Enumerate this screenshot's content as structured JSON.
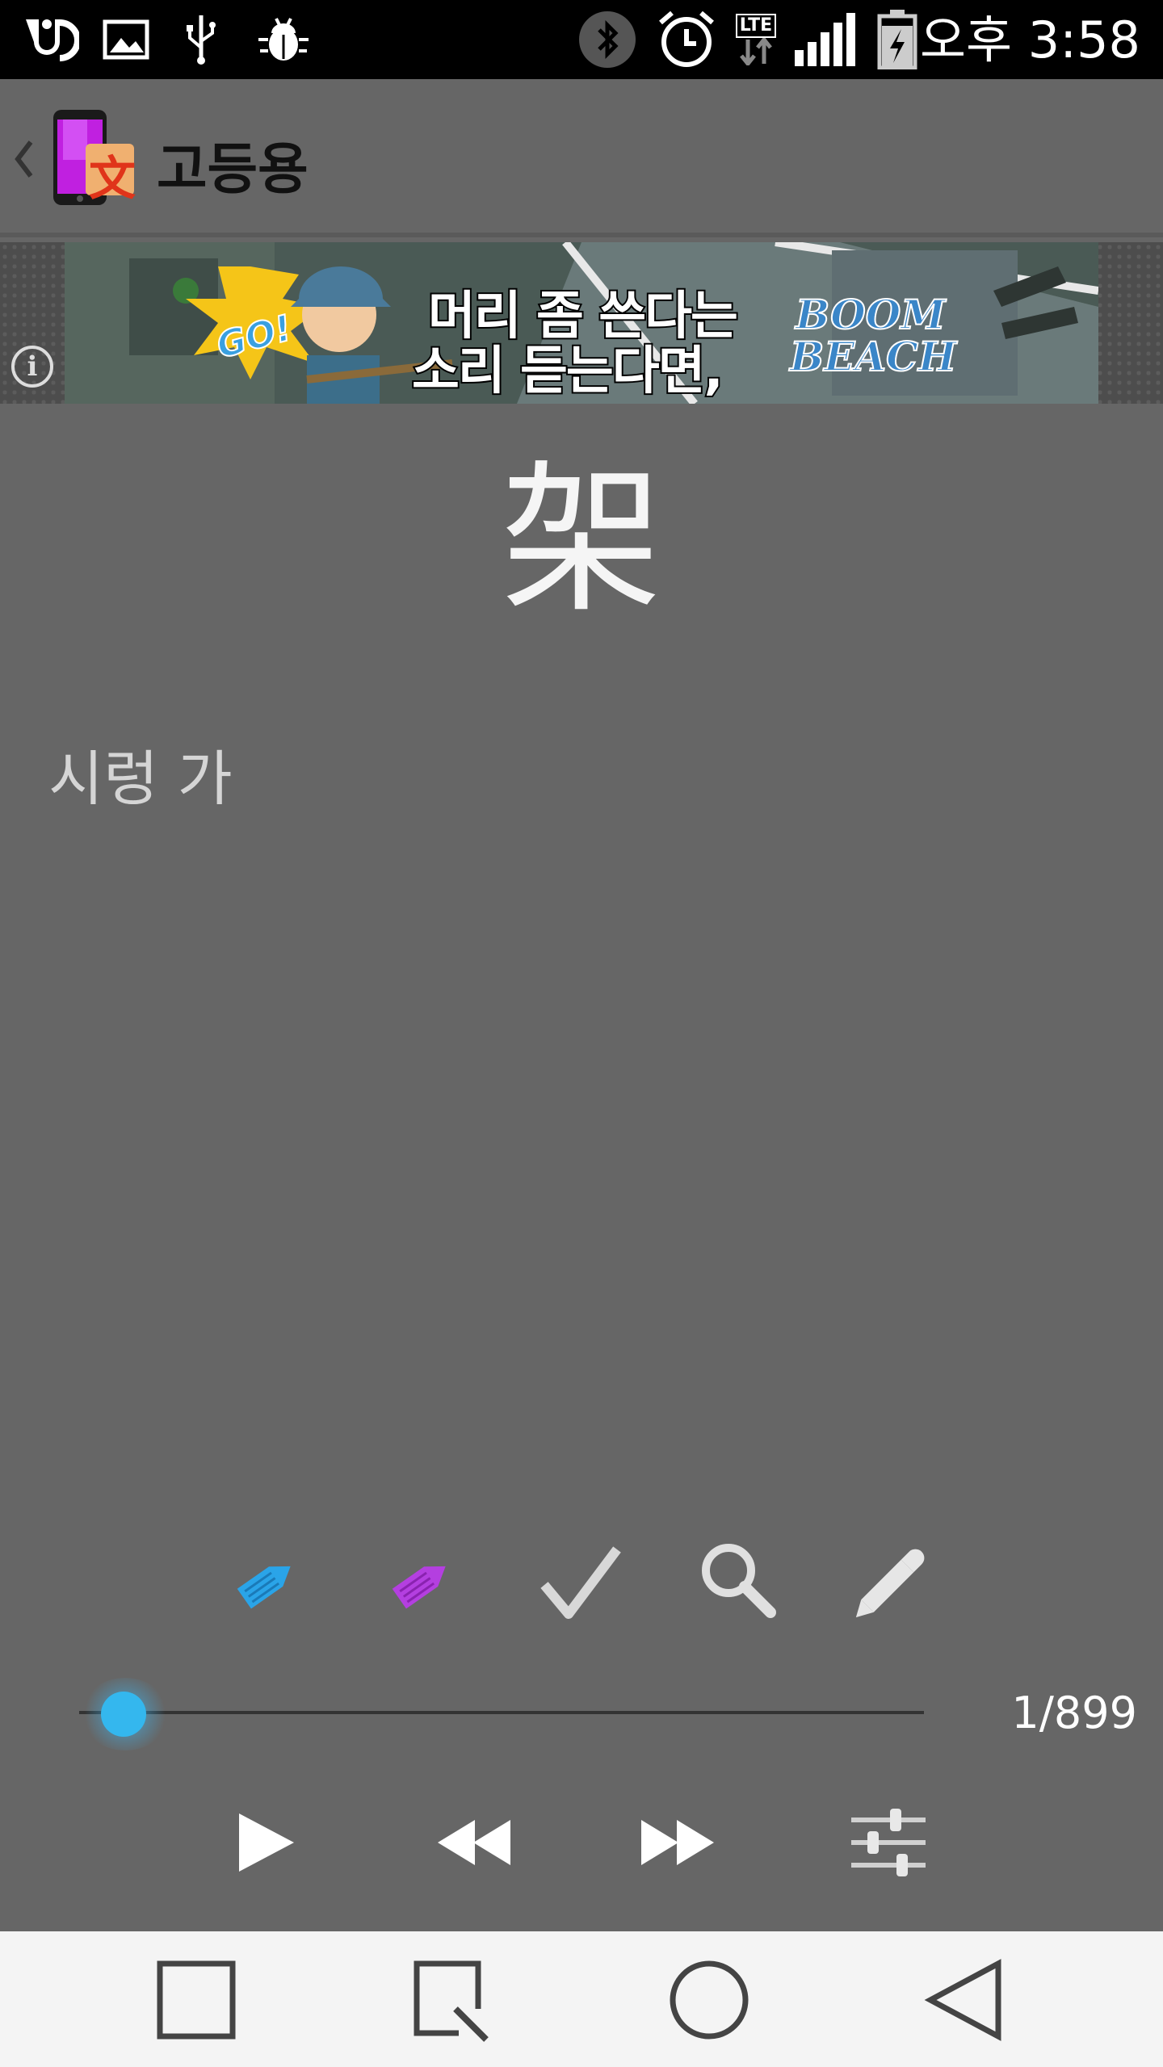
{
  "status_bar": {
    "time": "오후 3:58",
    "icons": [
      "uplus-icon",
      "gallery-icon",
      "usb-icon",
      "android-debug-icon",
      "bluetooth-icon",
      "alarm-icon",
      "lte-icon",
      "signal-icon",
      "battery-charging-icon"
    ],
    "lte_label": "LTE"
  },
  "action_bar": {
    "title": "고등용",
    "logo_glyph": "文"
  },
  "ad": {
    "badge": "GO!",
    "line1": "머리 좀 쓴다는",
    "line2": "소리 듣는다면,",
    "brand_line1": "BOOM",
    "brand_line2": "BEACH",
    "info_glyph": "i"
  },
  "card": {
    "hanja": "架",
    "meaning": "시렁 가"
  },
  "tools": {
    "items": [
      "edit-blue-icon",
      "edit-purple-icon",
      "check-icon",
      "search-icon",
      "pencil-icon"
    ],
    "accent_blue": "#2aa4e8",
    "accent_purple": "#b43fe0"
  },
  "progress": {
    "current": 1,
    "total": 899,
    "label": "1/899",
    "thumb_color": "#34b7ee"
  },
  "playback": {
    "items": [
      "play-icon",
      "rewind-icon",
      "fast-forward-icon",
      "settings-sliders-icon"
    ]
  },
  "nav_bar": {
    "items": [
      "recent-apps-icon",
      "dual-window-icon",
      "home-icon",
      "back-icon"
    ]
  }
}
